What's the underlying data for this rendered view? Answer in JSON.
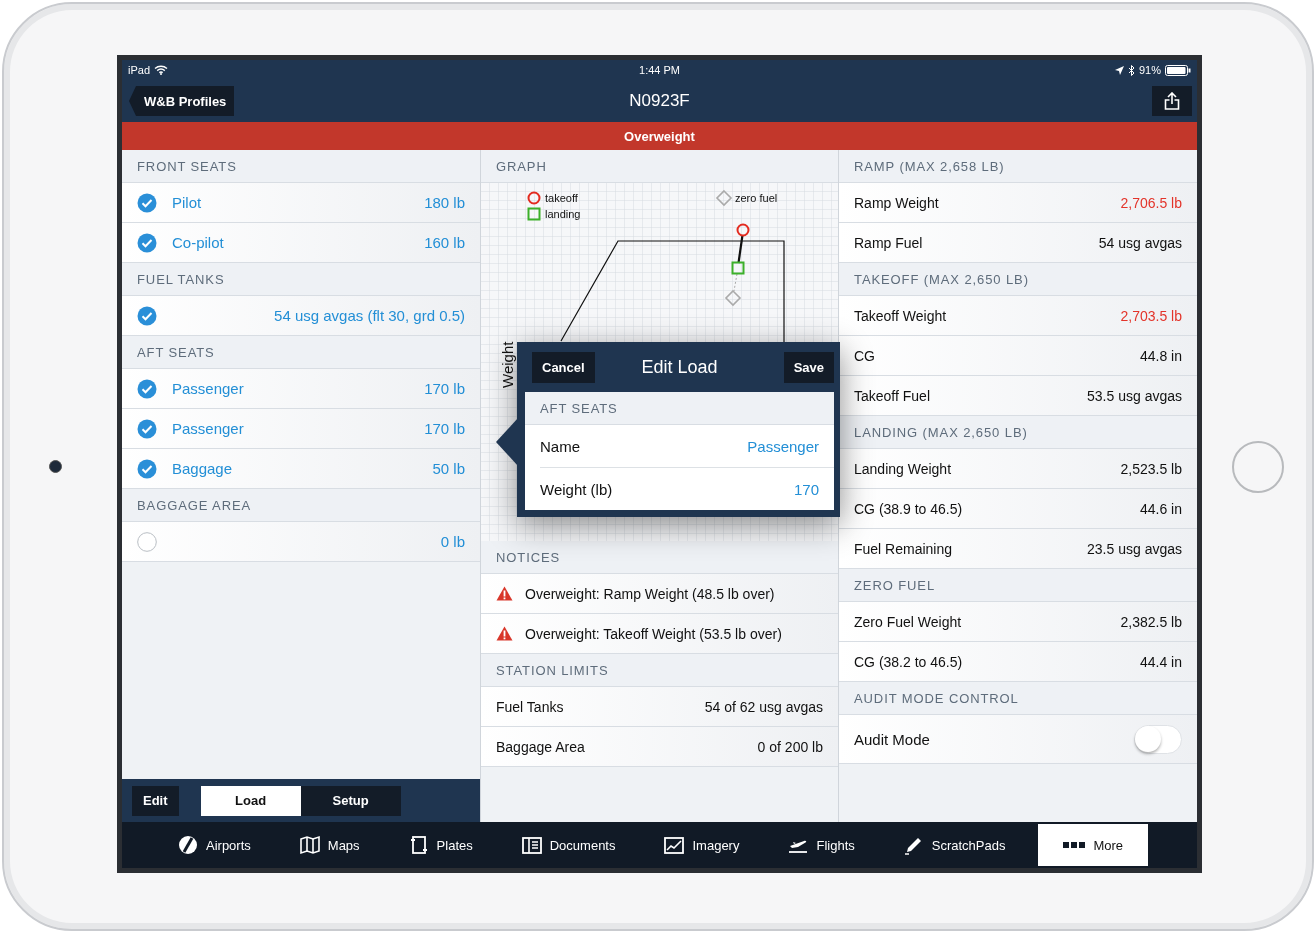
{
  "status_bar": {
    "device": "iPad",
    "time": "1:44 PM",
    "battery": "91%"
  },
  "nav": {
    "back": "W&B Profiles",
    "title": "N0923F"
  },
  "banner": "Overweight",
  "left": {
    "sections": [
      {
        "header": "FRONT SEATS",
        "rows": [
          {
            "checked": true,
            "label": "Pilot",
            "value": "180 lb"
          },
          {
            "checked": true,
            "label": "Co-pilot",
            "value": "160 lb"
          }
        ]
      },
      {
        "header": "FUEL TANKS",
        "rows": [
          {
            "checked": true,
            "value": "54 usg avgas (flt 30, grd 0.5)"
          }
        ]
      },
      {
        "header": "AFT SEATS",
        "rows": [
          {
            "checked": true,
            "label": "Passenger",
            "value": "170 lb"
          },
          {
            "checked": true,
            "label": "Passenger",
            "value": "170 lb"
          },
          {
            "checked": true,
            "label": "Baggage",
            "value": "50 lb"
          }
        ]
      },
      {
        "header": "BAGGAGE AREA",
        "rows": [
          {
            "checked": false,
            "value": "0 lb"
          }
        ]
      }
    ],
    "edit": "Edit",
    "segments": [
      {
        "label": "Load",
        "selected": true
      },
      {
        "label": "Setup",
        "selected": false
      }
    ]
  },
  "graph": {
    "header": "GRAPH",
    "ylabel": "Weight",
    "legend": [
      {
        "kind": "circle",
        "label": "takeoff"
      },
      {
        "kind": "square",
        "label": "landing"
      },
      {
        "kind": "diamond",
        "label": "zero fuel"
      }
    ]
  },
  "popover": {
    "cancel": "Cancel",
    "title": "Edit Load",
    "save": "Save",
    "header": "AFT SEATS",
    "rows": [
      {
        "label": "Name",
        "value": "Passenger"
      },
      {
        "label": "Weight (lb)",
        "value": "170"
      }
    ]
  },
  "notices": {
    "header": "NOTICES",
    "items": [
      "Overweight: Ramp Weight (48.5 lb over)",
      "Overweight: Takeoff Weight (53.5 lb over)"
    ]
  },
  "station_limits": {
    "header": "STATION LIMITS",
    "rows": [
      {
        "label": "Fuel Tanks",
        "value": "54 of 62 usg avgas"
      },
      {
        "label": "Baggage Area",
        "value": "0 of 200 lb"
      }
    ]
  },
  "right": {
    "sections": [
      {
        "header": "RAMP (MAX 2,658 LB)",
        "rows": [
          {
            "kind": "value",
            "label": "Ramp Weight",
            "value": "2,706.5 lb",
            "over": true
          },
          {
            "kind": "value",
            "label": "Ramp Fuel",
            "value": "54 usg avgas",
            "over": false
          }
        ]
      },
      {
        "header": "TAKEOFF (MAX 2,650 LB)",
        "rows": [
          {
            "kind": "value",
            "label": "Takeoff Weight",
            "value": "2,703.5 lb",
            "over": true
          },
          {
            "kind": "value",
            "label": "CG",
            "value": "44.8 in",
            "over": false
          },
          {
            "kind": "value",
            "label": "Takeoff Fuel",
            "value": "53.5 usg avgas",
            "over": false
          }
        ]
      },
      {
        "header": "LANDING (MAX 2,650 LB)",
        "rows": [
          {
            "kind": "value",
            "label": "Landing Weight",
            "value": "2,523.5 lb",
            "over": false
          },
          {
            "kind": "value",
            "label": "CG (38.9 to 46.5)",
            "value": "44.6 in",
            "over": false
          },
          {
            "kind": "value",
            "label": "Fuel Remaining",
            "value": "23.5 usg avgas",
            "over": false
          }
        ]
      },
      {
        "header": "ZERO FUEL",
        "rows": [
          {
            "kind": "value",
            "label": "Zero Fuel Weight",
            "value": "2,382.5 lb",
            "over": false
          },
          {
            "kind": "value",
            "label": "CG (38.2 to 46.5)",
            "value": "44.4 in",
            "over": false
          }
        ]
      },
      {
        "header": "AUDIT MODE CONTROL",
        "rows": [
          {
            "kind": "toggle",
            "label": "Audit Mode",
            "on": false
          }
        ]
      }
    ]
  },
  "tabbar": [
    {
      "label": "Airports",
      "selected": false
    },
    {
      "label": "Maps",
      "selected": false
    },
    {
      "label": "Plates",
      "selected": false
    },
    {
      "label": "Documents",
      "selected": false
    },
    {
      "label": "Imagery",
      "selected": false
    },
    {
      "label": "Flights",
      "selected": false
    },
    {
      "label": "ScratchPads",
      "selected": false
    },
    {
      "label": "More",
      "selected": true
    }
  ]
}
